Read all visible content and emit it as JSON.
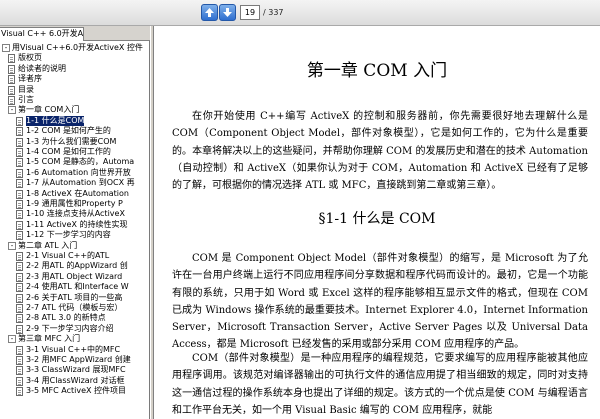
{
  "toolbar": {
    "page_current": "19",
    "page_total": "/ 337",
    "prev_icon": "arrow-up-icon",
    "next_icon": "arrow-down-icon"
  },
  "tab": {
    "label": "Visual C++ 6.0开发Act..."
  },
  "bookmarks": [
    {
      "label": "用Visual C++6.0开发ActiveX 控件",
      "type": "toggle",
      "state": "-",
      "level": 0
    },
    {
      "label": "版权页",
      "type": "page",
      "level": 1
    },
    {
      "label": "给读者的说明",
      "type": "page",
      "level": 1
    },
    {
      "label": "译者序",
      "type": "page",
      "level": 1
    },
    {
      "label": "目录",
      "type": "page",
      "level": 1
    },
    {
      "label": "引言",
      "type": "page",
      "level": 1
    },
    {
      "label": "第一章  COM入门",
      "type": "toggle",
      "state": "-",
      "level": 1
    },
    {
      "label": "1-1 什么是COM",
      "type": "page",
      "level": 2,
      "selected": true
    },
    {
      "label": "1-2 COM 是如何产生的",
      "type": "page",
      "level": 2
    },
    {
      "label": "1-3 为什么我们需要COM",
      "type": "page",
      "level": 2
    },
    {
      "label": "1-4 COM 是如何工作的",
      "type": "page",
      "level": 2
    },
    {
      "label": "1-5 COM 是静态的，Automa",
      "type": "page",
      "level": 2
    },
    {
      "label": "1-6 Automation 向世界开放",
      "type": "page",
      "level": 2
    },
    {
      "label": "1-7 从Automation 到OCX 再",
      "type": "page",
      "level": 2
    },
    {
      "label": "1-8 ActiveX 在Automation",
      "type": "page",
      "level": 2
    },
    {
      "label": "1-9 通用属性和Property P",
      "type": "page",
      "level": 2
    },
    {
      "label": "1-10 连接点支持从ActiveX",
      "type": "page",
      "level": 2
    },
    {
      "label": "1-11 ActiveX 的持续性实现",
      "type": "page",
      "level": 2
    },
    {
      "label": "1-12 下一步学习的内容",
      "type": "page",
      "level": 2
    },
    {
      "label": "第二章  ATL 入门",
      "type": "toggle",
      "state": "-",
      "level": 1
    },
    {
      "label": "2-1 Visual C++的ATL",
      "type": "page",
      "level": 2
    },
    {
      "label": "2-2 用ATL 的AppWizard 创",
      "type": "page",
      "level": 2
    },
    {
      "label": "2-3 用ATL Object Wizard",
      "type": "page",
      "level": 2
    },
    {
      "label": "2-4 使用ATL 和Interface W",
      "type": "page",
      "level": 2
    },
    {
      "label": "2-6 关于ATL 项目的一些高",
      "type": "page",
      "level": 2
    },
    {
      "label": "2-7 ATL 代码（模板与宏）",
      "type": "page",
      "level": 2
    },
    {
      "label": "2-8 ATL 3.0 的新特点",
      "type": "page",
      "level": 2
    },
    {
      "label": "2-9 下一步学习内容介绍",
      "type": "page",
      "level": 2
    },
    {
      "label": "第三章  MFC 入门",
      "type": "toggle",
      "state": "-",
      "level": 1
    },
    {
      "label": "3-1 Visual C++中的MFC",
      "type": "page",
      "level": 2
    },
    {
      "label": "3-2 用MFC AppWizard 创建",
      "type": "page",
      "level": 2
    },
    {
      "label": "3-3 ClassWizard 展现MFC",
      "type": "page",
      "level": 2
    },
    {
      "label": "3-4 用ClassWizard 对话框",
      "type": "page",
      "level": 2
    },
    {
      "label": "3-5 MFC ActiveX 控件项目",
      "type": "page",
      "level": 2
    }
  ],
  "document": {
    "chapter_title": "第一章    COM 入门",
    "intro": "在你开始使用 C++编写 ActiveX 的控制和服务器前，你先需要很好地去理解什么是 COM（Component Object Model，部件对象模型），它是如何工作的，它为什么是重要的。本章将解决以上的这些疑问，并帮助你理解 COM 的发展历史和潜在的技术 Automation（自动控制）和 ActiveX（如果你认为对于 COM，Automation 和 ActiveX 已经有了足够的了解，可根据你的情况选择 ATL 或 MFC，直接跳到第二章或第三章）。",
    "section_title": "§1-1    什么是 COM",
    "para1": "COM 是 Component Object Model（部件对象模型）的缩写，是 Microsoft 为了允许在一台用户终端上运行不同应用程序间分享数据和程序代码而设计的。最初，它是一个功能有限的系统，只用于如 Word 或 Excel 这样的程序能够相互显示文件的格式，但现在 COM 已成为 Windows 操作系统的最重要技术。Internet Explorer 4.0，Internet Information Server，Microsoft Transaction Server，Active Server Pages 以及 Universal Data Access，都是 Microsoft 已经发售的采用或部分采用 COM 应用程序的产品。",
    "para2": "COM（部件对象模型）是一种应用程序的编程规范，它要求编写的应用程序能被其他应用程序调用。该规范对编译器输出的可执行文件的通信应用提了相当细致的规定，同时对支持这一通信过程的操作系统本身也提出了详细的规定。该方式的一个优点是使 COM 与编程语言和工作平台无关，如一个用 Visual Basic 编写的 COM 应用程序，就能"
  }
}
